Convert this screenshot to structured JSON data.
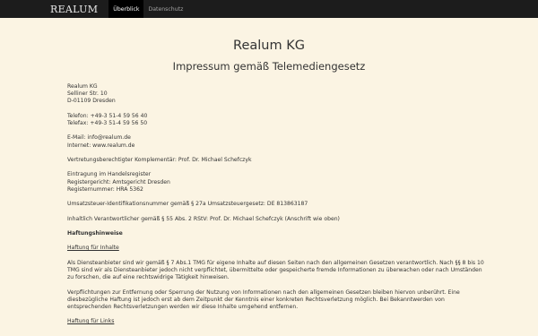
{
  "nav": {
    "brand": "REALUM",
    "items": [
      {
        "label": "Überblick",
        "active": true
      },
      {
        "label": "Datenschutz",
        "active": false
      }
    ]
  },
  "page": {
    "title": "Realum KG",
    "subtitle": "Impressum gemäß Telemediengesetz"
  },
  "address": {
    "name": "Realum KG",
    "street": "Selliner Str. 10",
    "city": "D-01109 Dresden"
  },
  "contact": {
    "phone": "Telefon: +49-3 51-4 59 56 40",
    "fax": "Telefax: +49-3 51-4 59 56 50",
    "email": "E-Mail: info@realum.de",
    "web": "Internet: www.realum.de"
  },
  "representative": "Vertretungsberechtigter Komplementär: Prof. Dr. Michael Schefczyk",
  "register": {
    "line1": "Eintragung im Handelsregister",
    "line2": "Registergericht: Amtsgericht Dresden",
    "line3": "Registernummer: HRA 5362"
  },
  "vat": "Umsatzsteuer-Identifikationsnummer gemäß § 27a Umsatzsteuergesetz: DE 813863187",
  "responsible": "Inhaltlich Verantwortlicher gemäß § 55 Abs. 2 RStV: Prof. Dr. Michael Schefczyk (Anschrift wie oben)",
  "liability": {
    "heading": "Haftungshinweise",
    "content_heading": "Haftung für Inhalte",
    "para1": "Als Diensteanbieter sind wir gemäß § 7 Abs.1 TMG für eigene Inhalte auf diesen Seiten nach den allgemeinen Gesetzen verantwortlich. Nach §§ 8 bis 10 TMG sind wir als Diensteanbieter jedoch nicht verpflichtet, übermittelte oder gespeicherte fremde Informationen zu überwachen oder nach Umständen zu forschen, die auf eine rechtswidrige Tätigkeit hinweisen.",
    "para2": "Verpflichtungen zur Entfernung oder Sperrung der Nutzung von Informationen nach den allgemeinen Gesetzen bleiben hiervon unberührt. Eine diesbezügliche Haftung ist jedoch erst ab dem Zeitpunkt der Kenntnis einer konkreten Rechtsverletzung möglich. Bei Bekanntwerden von entsprechenden Rechtsverletzungen werden wir diese Inhalte umgehend entfernen.",
    "links_heading": "Haftung für Links"
  }
}
